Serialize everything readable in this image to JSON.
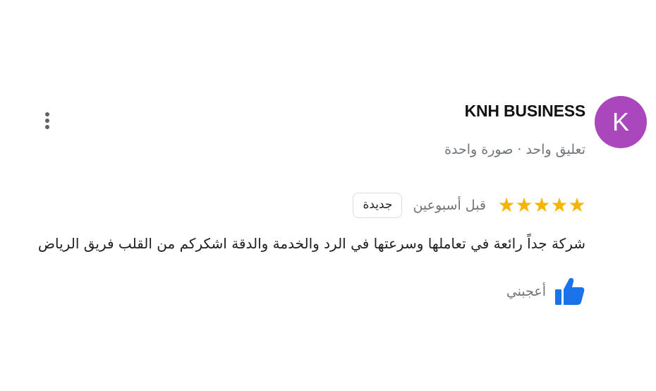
{
  "review": {
    "author": {
      "initial": "K",
      "name": "KNH BUSINESS",
      "meta": "تعليق واحد · صورة واحدة",
      "avatar_color": "#ab47bc"
    },
    "rating": {
      "stars": 5,
      "max_stars": 5,
      "star_glyph": "★",
      "star_color": "#f4b400"
    },
    "time": "قبل أسبوعين",
    "badge": "جديدة",
    "text": "شركة جداً رائعة في تعاملها وسرعتها في الرد والخدمة والدقة اشكركم من القلب فريق الرياض",
    "like": {
      "label": "أعجبني",
      "icon": "thumbs-up-icon",
      "icon_color": "#1a73e8"
    },
    "more_icon": "more-vertical-icon"
  }
}
